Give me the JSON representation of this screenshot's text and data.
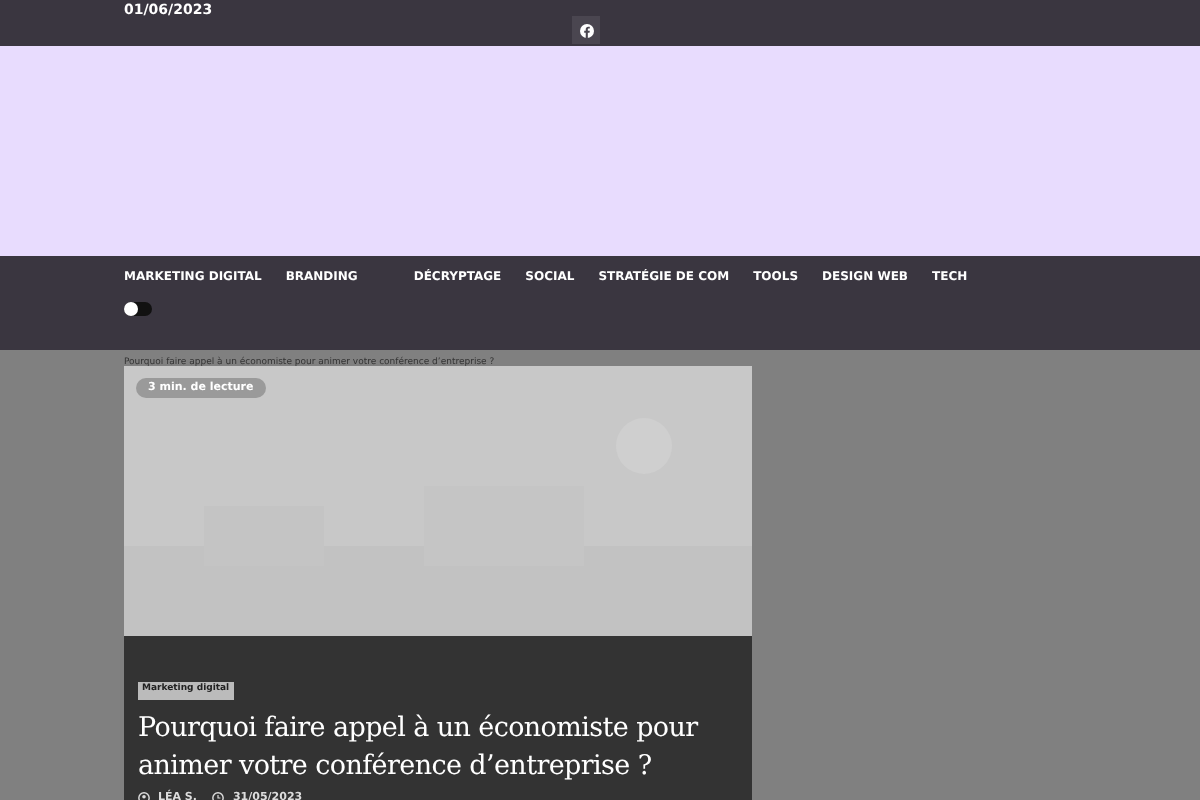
{
  "top_bar": {
    "date": "01/06/2023"
  },
  "nav": {
    "items": [
      "MARKETING DIGITAL",
      "BRANDING",
      "DÉCRYPTAGE",
      "SOCIAL",
      "STRATÉGIE DE COM",
      "TOOLS",
      "DESIGN WEB",
      "TECH"
    ],
    "dark_mode": {
      "on": false
    }
  },
  "ticker": "Pourquoi faire appel à un économiste pour animer votre conférence d’entreprise ?",
  "post": {
    "reading_time": "3 min. de lecture",
    "category": "Marketing digital",
    "title": "Pourquoi faire appel à un économiste pour animer votre conférence d’entreprise ?",
    "author": "LÉA S.",
    "date": "31/05/2023"
  }
}
